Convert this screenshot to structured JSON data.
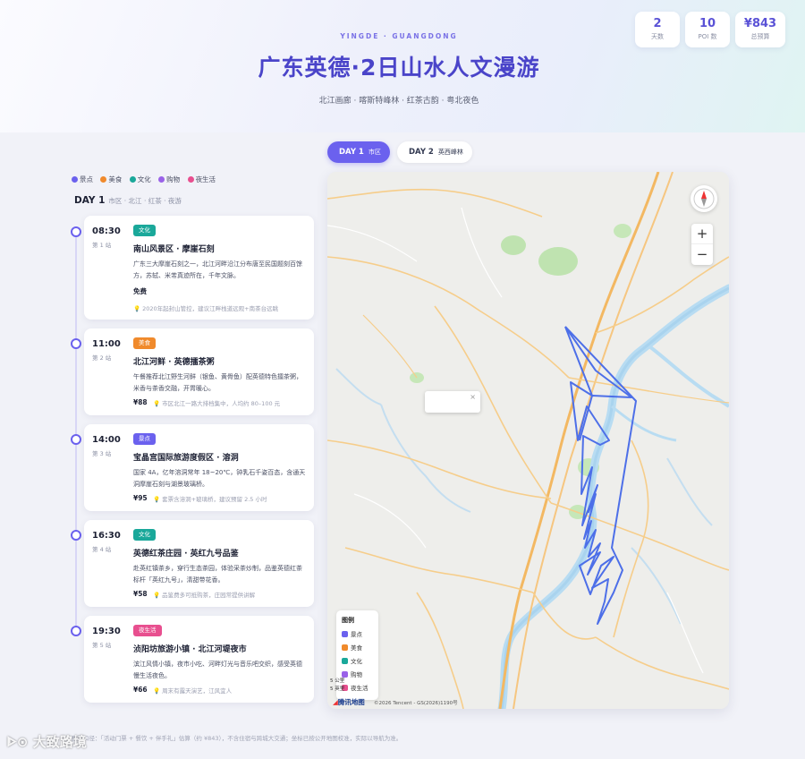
{
  "hero": {
    "eyebrow": "YINGDE · GUANGDONG",
    "title": "广东英德·2日山水人文漫游",
    "subtitle": "北江画廊 · 喀斯特峰林 · 红茶古韵 · 粤北夜色"
  },
  "stats": [
    {
      "value": "2",
      "label": "天数"
    },
    {
      "value": "10",
      "label": "POI 数"
    },
    {
      "value": "¥843",
      "label": "总预算"
    }
  ],
  "tabs": [
    {
      "label": "DAY 1",
      "sub": "市区",
      "active": true
    },
    {
      "label": "DAY 2",
      "sub": "英西峰林",
      "active": false
    }
  ],
  "legend": [
    {
      "label": "景点",
      "color": "#6b61ee"
    },
    {
      "label": "美食",
      "color": "#f08a2c"
    },
    {
      "label": "文化",
      "color": "#1aa89a"
    },
    {
      "label": "购物",
      "color": "#9a62e8"
    },
    {
      "label": "夜生活",
      "color": "#e84f8f"
    }
  ],
  "day": {
    "title": "DAY 1",
    "subtitle": "市区 · 北江 · 红茶 · 夜游"
  },
  "stops": [
    {
      "time": "08:30",
      "index": "第 1 站",
      "category": "文化",
      "category_color": "#1aa89a",
      "title": "南山风景区 · 摩崖石刻",
      "desc": "广东三大摩崖石刻之一，北江河畔沿江分布唐至民国题刻百馀方，苏轼、米芾真迹所在，千年文脉。",
      "price": "免费",
      "tip": "2020年起封山管控，建议江畔栈道远观+南茶台远眺"
    },
    {
      "time": "11:00",
      "index": "第 2 站",
      "category": "美食",
      "category_color": "#f08a2c",
      "title": "北江河鲜 · 英德擂茶粥",
      "desc": "午餐推荐北江野生河鲜（银鱼、黄骨鱼）配英德特色擂茶粥，米香与茶香交融，开胃暖心。",
      "price": "¥88",
      "tip": "市区北江一路大排档集中，人均约 80–100 元"
    },
    {
      "time": "14:00",
      "index": "第 3 站",
      "category": "景点",
      "category_color": "#6b61ee",
      "title": "宝晶宫国际旅游度假区 · 溶洞",
      "desc": "国家 4A，亿年溶洞常年 18~20℃，钟乳石千姿百态，含通天洞摩崖石刻与湖景玻璃桥。",
      "price": "¥95",
      "tip": "套票含溶洞+玻璃桥，建议预留 2.5 小时"
    },
    {
      "time": "16:30",
      "index": "第 4 站",
      "category": "文化",
      "category_color": "#1aa89a",
      "title": "英德红茶庄园 · 英红九号品鉴",
      "desc": "赴英红镇茶乡，穿行生态茶园，体验采茶炒制，品鉴英德红茶标杆「英红九号」，清甜带花香。",
      "price": "¥58",
      "tip": "品鉴费多可抵购茶，庄园常提供讲解"
    },
    {
      "time": "19:30",
      "index": "第 5 站",
      "category": "夜生活",
      "category_color": "#e84f8f",
      "title": "浈阳坊旅游小镇 · 北江河堤夜市",
      "desc": "滨江风情小镇，夜市小吃、河畔灯光与音乐吧交织，感受英德慢生活夜色。",
      "price": "¥66",
      "tip": "周末有露天演艺，江风宜人"
    }
  ],
  "map": {
    "legend_title": "图例",
    "legend": [
      {
        "label": "景点",
        "color": "#6b61ee"
      },
      {
        "label": "美食",
        "color": "#f08a2c"
      },
      {
        "label": "文化",
        "color": "#1aa89a"
      },
      {
        "label": "购物",
        "color": "#9a62e8"
      },
      {
        "label": "夜生活",
        "color": "#e84f8f"
      }
    ],
    "zoom_in": "+",
    "zoom_out": "−",
    "popup_close": "×",
    "scale_1": "5 公里",
    "scale_2": "5 英里",
    "brand": "腾讯地图",
    "copyright": "©2026 Tencent - GS(2026)1190号"
  },
  "footnote": "预算口径：「活动门票 + 餐饮 + 伴手礼」估算（约 ¥843），不含住宿与跨城大交通；坐标已按公开地图校准，实际以导航为准。",
  "watermark": "大致路境"
}
